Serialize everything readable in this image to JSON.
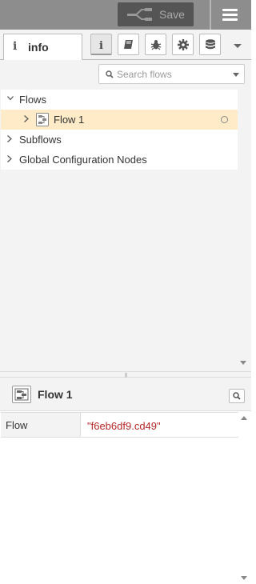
{
  "header": {
    "deploy_label": "Save",
    "deploy_icon": "deploy-icon",
    "menu_icon": "hamburger-menu-icon"
  },
  "tabs": {
    "info_label": "info",
    "info_icon": "i",
    "buttons": [
      {
        "name": "info-tab-button",
        "icon": "info-icon",
        "active": true
      },
      {
        "name": "help-tab-button",
        "icon": "book-icon",
        "active": false
      },
      {
        "name": "debug-tab-button",
        "icon": "bug-icon",
        "active": false
      },
      {
        "name": "config-tab-button",
        "icon": "gear-icon",
        "active": false
      },
      {
        "name": "context-tab-button",
        "icon": "database-icon",
        "active": false
      }
    ]
  },
  "search": {
    "placeholder": "Search flows"
  },
  "tree": {
    "flows_label": "Flows",
    "flow_item_label": "Flow 1",
    "subflows_label": "Subflows",
    "global_config_label": "Global Configuration Nodes"
  },
  "info_panel": {
    "title": "Flow 1",
    "properties": [
      {
        "key": "Flow",
        "value": "\"f6eb6df9.cd49\""
      }
    ]
  },
  "colors": {
    "header_bg": "#8d8d8d",
    "deploy_bg": "#555555",
    "selected_row_bg": "#ffebc7",
    "prop_value": "#b72828"
  }
}
